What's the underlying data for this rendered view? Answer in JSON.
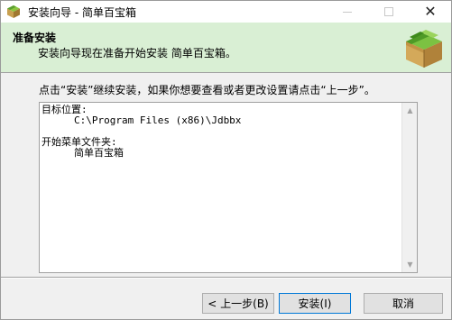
{
  "window": {
    "title": "安装向导 - 简单百宝箱",
    "minimize_icon": "minimize-icon",
    "maximize_icon": "maximize-icon",
    "close_label": "✕"
  },
  "header": {
    "title": "准备安装",
    "subtitle": "安装向导现在准备开始安装 简单百宝箱。"
  },
  "body": {
    "instruction": "点击“安装”继续安装，如果你想要查看或者更改设置请点击“上一步”。",
    "summary_lines": [
      {
        "text": "目标位置:",
        "indent": false
      },
      {
        "text": "C:\\Program Files (x86)\\Jdbbx",
        "indent": true
      },
      {
        "text": "",
        "indent": false
      },
      {
        "text": "开始菜单文件夹:",
        "indent": false
      },
      {
        "text": "简单百宝箱",
        "indent": true
      }
    ]
  },
  "buttons": {
    "back": "< 上一步(B)",
    "install": "安装(I)",
    "cancel": "取消"
  },
  "colors": {
    "header_bg": "#d9efd4",
    "default_button_border": "#0078d7"
  }
}
